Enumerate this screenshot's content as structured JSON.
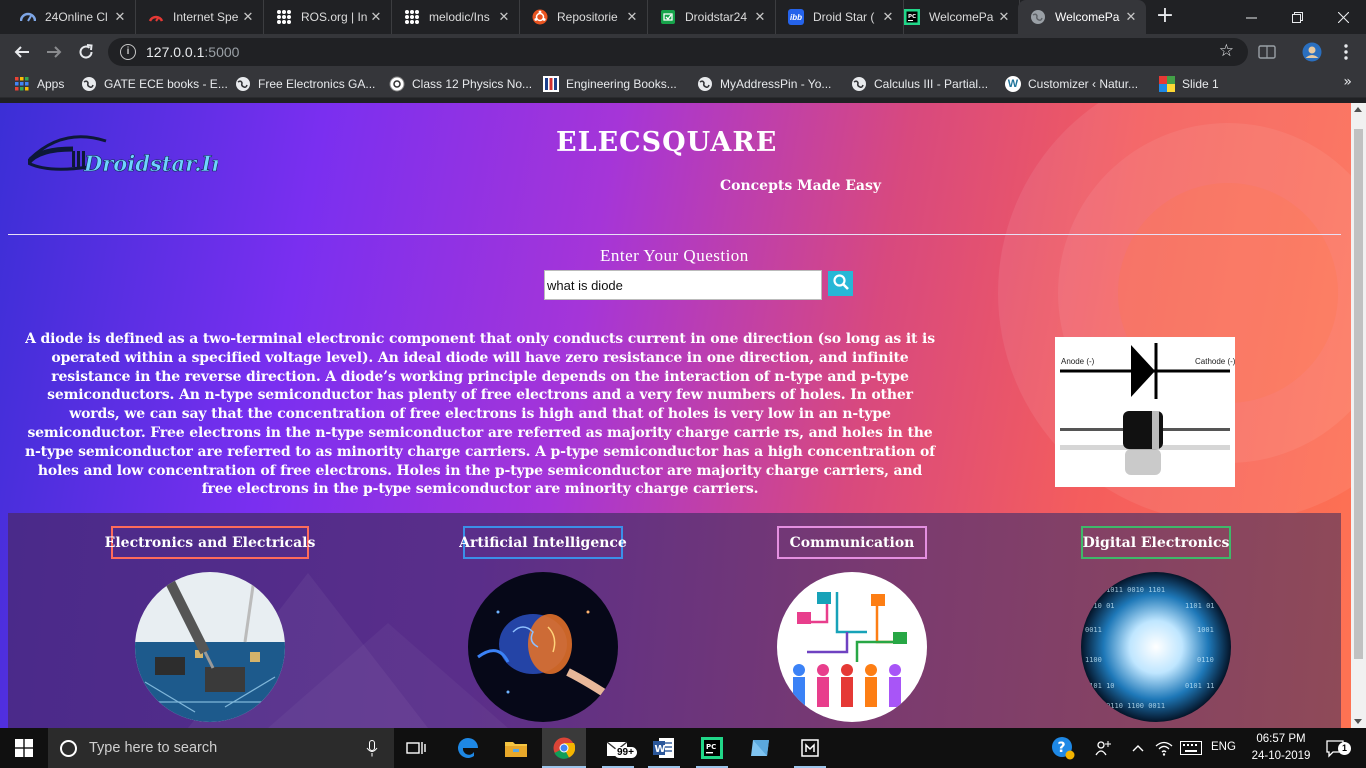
{
  "browser": {
    "tabs": [
      {
        "title": "24Online Cl",
        "icon": "24online-icon",
        "color": "#5b8dd9"
      },
      {
        "title": "Internet Spe",
        "icon": "speedtest-icon",
        "color": "#e53935"
      },
      {
        "title": "ROS.org | In",
        "icon": "ros-icon",
        "color": "#ffffff"
      },
      {
        "title": "melodic/Ins",
        "icon": "ros-wiki-icon",
        "color": "#ffffff"
      },
      {
        "title": "Repositorie",
        "icon": "ubuntu-icon",
        "color": "#e95420"
      },
      {
        "title": "Droidstar24",
        "icon": "droidstar-icon",
        "color": "#16a34a"
      },
      {
        "title": "Droid Star (",
        "icon": "ibb-icon",
        "color": "#2563eb"
      },
      {
        "title": "WelcomePa",
        "icon": "pycharm-icon",
        "color": "#21d789"
      },
      {
        "title": "WelcomePa",
        "icon": "globe-icon",
        "color": "#8a8a8a"
      }
    ],
    "url": "127.0.0.1:5000",
    "url_host": "127.0.0.1",
    "url_port": ":5000",
    "bookmarks": [
      {
        "label": "Apps",
        "icon": "apps-grid-icon"
      },
      {
        "label": "GATE ECE books - E...",
        "icon": "globe-icon"
      },
      {
        "label": "Free Electronics GA...",
        "icon": "globe-icon"
      },
      {
        "label": "Class 12 Physics No...",
        "icon": "class12-icon"
      },
      {
        "label": "Engineering Books...",
        "icon": "engg-books-icon"
      },
      {
        "label": "MyAddressPin - Yo...",
        "icon": "globe-icon"
      },
      {
        "label": "Calculus III - Partial...",
        "icon": "globe-icon"
      },
      {
        "label": "Customizer ‹ Natur...",
        "icon": "wordpress-icon"
      },
      {
        "label": "Slide 1",
        "icon": "slide-icon"
      }
    ],
    "bookmarks_more": "»"
  },
  "page": {
    "logo_text": "Droidstar.Inc",
    "title": "ELECSQUARE",
    "tagline": "Concepts Made Easy",
    "question_label": "Enter Your Question",
    "question_value": "what is diode",
    "answer": "A diode is defined as a two-terminal electronic component that only conducts current in one direction (so long as it is operated within a specified voltage level). An ideal diode will have zero resistance in one direction, and infinite resistance in the reverse direction. A diode’s working principle depends on the interaction of n-type and p-type semiconductors. An n-type semiconductor has plenty of free electrons and a very few numbers of holes. In other words, we can say that the concentration of free electrons is high and that of holes is very low in an n-type semiconductor. Free electrons in the n-type semiconductor are referred as majority charge carrie rs, and holes in the n-type semiconductor are referred to as minority charge carriers. A p-type semiconductor has a high concentration of holes and low concentration of free electrons. Holes in the p-type semiconductor are majority charge carriers, and free electrons in the p-type semiconductor are minority charge carriers.",
    "diode_image": {
      "anode_label": "Anode (-)",
      "cathode_label": "Cathode (-)"
    },
    "categories": [
      {
        "label": "Electronics and Electricals",
        "border": "#ff6b5b"
      },
      {
        "label": "Artificial Intelligence",
        "border": "#3b8fe8"
      },
      {
        "label": "Communication",
        "border": "#e48fe0"
      },
      {
        "label": "Digital Electronics",
        "border": "#3fb86a"
      }
    ]
  },
  "taskbar": {
    "search_placeholder": "Type here to search",
    "mail_badge": "99+",
    "language": "ENG",
    "time": "06:57 PM",
    "date": "24-10-2019",
    "notifications": "1"
  }
}
